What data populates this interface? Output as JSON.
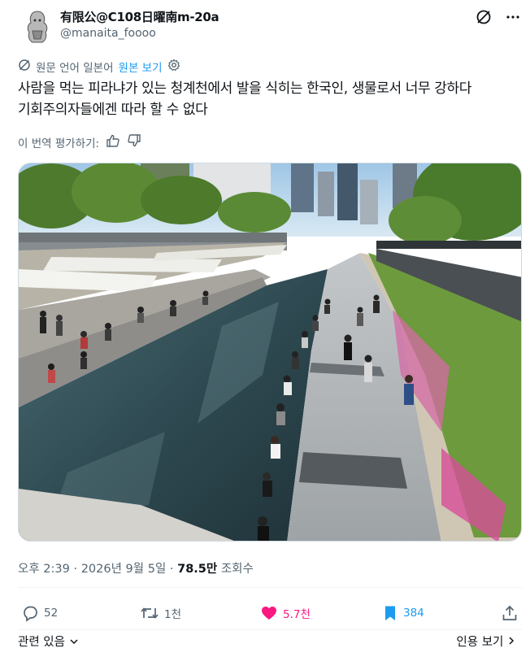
{
  "author": {
    "display_name": "有限公@C108日曜南m-20a",
    "handle": "@manaita_foooo"
  },
  "header": {
    "grok_icon": "grok-slash-icon",
    "more_icon": "more-dots-icon"
  },
  "translation": {
    "label": "원문 언어 일본어",
    "show_original": "원본 보기",
    "settings_icon": "gear-icon"
  },
  "post": {
    "line1": "사람을 먹는 피라냐가 있는 청계천에서 발을 식히는 한국인, 생물로서 너무 강하다",
    "line2": "기회주의자들에겐 따라 할 수 없다"
  },
  "rate": {
    "label": "이 번역 평가하기:"
  },
  "image": {
    "description_icon": "photo-of-cheonggyecheon-stream"
  },
  "meta": {
    "time": "오후 2:39",
    "sep": "·",
    "date": "2026년 9월 5일",
    "views_count": "78.5만",
    "views_label": "조회수"
  },
  "actions": {
    "replies": "52",
    "reposts": "1천",
    "likes": "5.7천",
    "bookmarks": "384"
  },
  "footer": {
    "related": "관련 있음",
    "quotes": "인용 보기"
  },
  "colors": {
    "like": "#f91880",
    "bookmark": "#1d9bf0",
    "link": "#1d9bf0",
    "secondary_text": "#536471"
  }
}
